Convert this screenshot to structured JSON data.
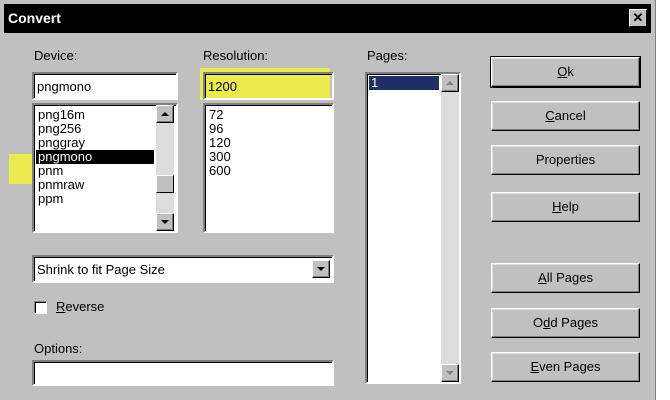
{
  "window": {
    "title": "Convert",
    "close_glyph": "✕"
  },
  "device": {
    "label": "Device:",
    "value": "pngmono",
    "items": [
      "png16m",
      "png256",
      "pnggray",
      "pngmono",
      "pnm",
      "pnmraw",
      "ppm"
    ],
    "selected": "pngmono"
  },
  "resolution": {
    "label": "Resolution:",
    "value": "1200",
    "items": [
      "72",
      "96",
      "120",
      "300",
      "600"
    ]
  },
  "pages": {
    "label": "Pages:",
    "items": [
      "1"
    ],
    "selected": "1"
  },
  "buttons": {
    "ok": {
      "pre": "",
      "key": "O",
      "post": "k"
    },
    "cancel": {
      "pre": "",
      "key": "C",
      "post": "ancel"
    },
    "properties": "Properties",
    "help": {
      "pre": "",
      "key": "H",
      "post": "elp"
    },
    "all_pages": {
      "pre": "",
      "key": "A",
      "post": "ll Pages"
    },
    "odd_pages": {
      "pre": "O",
      "key": "d",
      "post": "d Pages"
    },
    "even_pages": {
      "pre": "",
      "key": "E",
      "post": "ven Pages"
    }
  },
  "fit": {
    "value": "Shrink to fit Page Size"
  },
  "reverse": {
    "pre": "",
    "key": "R",
    "post": "everse",
    "checked": false
  },
  "options": {
    "label": "Options:",
    "value": ""
  },
  "colors": {
    "selection": "#000000",
    "pages_selection": "#1f2f6a",
    "highlight": "#f2f23a",
    "dialog": "#c0c0c0"
  }
}
